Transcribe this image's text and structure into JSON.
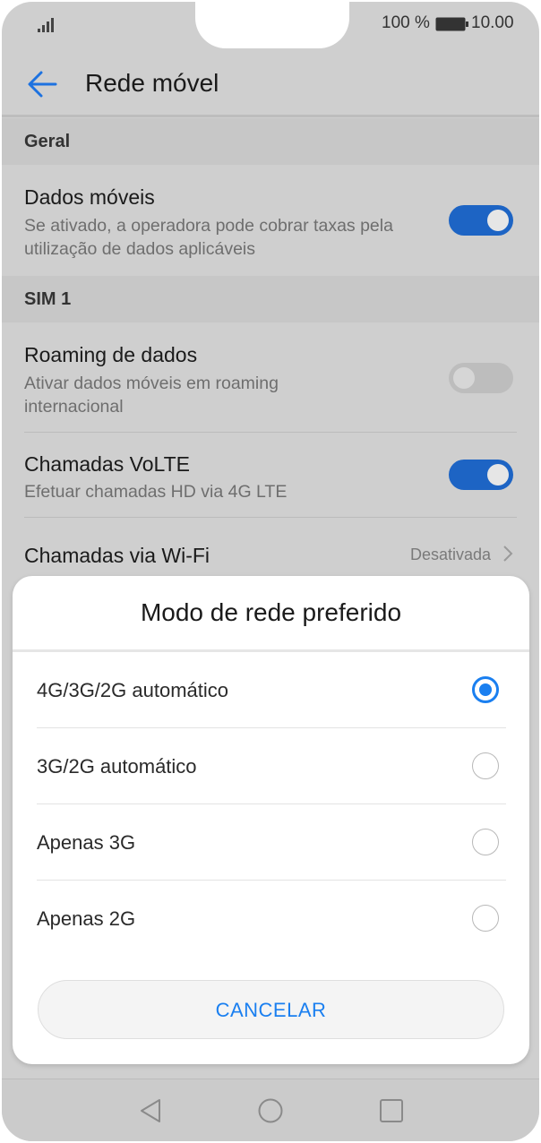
{
  "status": {
    "battery_text": "100 %",
    "time": "10.00"
  },
  "header": {
    "title": "Rede móvel"
  },
  "sections": {
    "general": "Geral",
    "sim1": "SIM 1"
  },
  "rows": {
    "mobile_data": {
      "title": "Dados móveis",
      "subtitle": "Se ativado, a operadora pode cobrar taxas pela utilização de dados aplicáveis",
      "enabled": true
    },
    "roaming": {
      "title": "Roaming de dados",
      "subtitle": "Ativar dados móveis em roaming internacional",
      "enabled": false
    },
    "volte": {
      "title": "Chamadas VoLTE",
      "subtitle": "Efetuar chamadas HD via 4G LTE",
      "enabled": true
    },
    "wifi_calling": {
      "title": "Chamadas via Wi-Fi",
      "status": "Desativada"
    }
  },
  "dialog": {
    "title": "Modo de rede preferido",
    "options": [
      {
        "label": "4G/3G/2G automático",
        "selected": true
      },
      {
        "label": "3G/2G automático",
        "selected": false
      },
      {
        "label": "Apenas 3G",
        "selected": false
      },
      {
        "label": "Apenas 2G",
        "selected": false
      }
    ],
    "cancel_label": "CANCELAR"
  },
  "colors": {
    "accent": "#1a7ff0",
    "toggle_on": "#1d64c4"
  }
}
